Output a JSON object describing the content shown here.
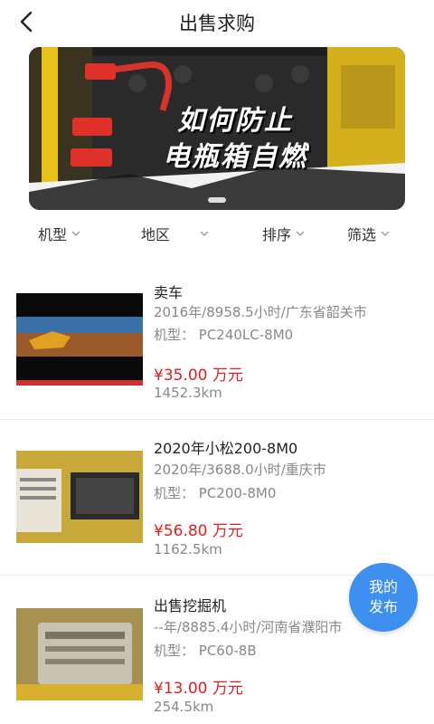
{
  "header": {
    "title": "出售求购",
    "back_icon": "chevron-left-icon"
  },
  "banner": {
    "line1": "如何防止",
    "line2": "电瓶箱自燃"
  },
  "filters": [
    {
      "label": "机型"
    },
    {
      "label": "地区"
    },
    {
      "label": "排序"
    },
    {
      "label": "筛选"
    }
  ],
  "listings": [
    {
      "title": "卖车",
      "info": "2016年/8958.5小时/广东省韶关市",
      "model": "机型：  PC240LC-8M0",
      "price": "¥35.00 万元",
      "distance": "1452.3km"
    },
    {
      "title": "2020年小松200-8M0",
      "info": "2020年/3688.0小时/重庆市",
      "model": "机型：  PC200-8M0",
      "price": "¥56.80 万元",
      "distance": "1162.5km"
    },
    {
      "title": "出售挖掘机",
      "info": "--年/8885.4小时/河南省濮阳市",
      "model": "机型：  PC60-8B",
      "price": "¥13.00 万元",
      "distance": "254.5km"
    }
  ],
  "fab": {
    "line1": "我的",
    "line2": "发布"
  },
  "colors": {
    "price": "#e02020",
    "fab": "#3d8ff0"
  }
}
